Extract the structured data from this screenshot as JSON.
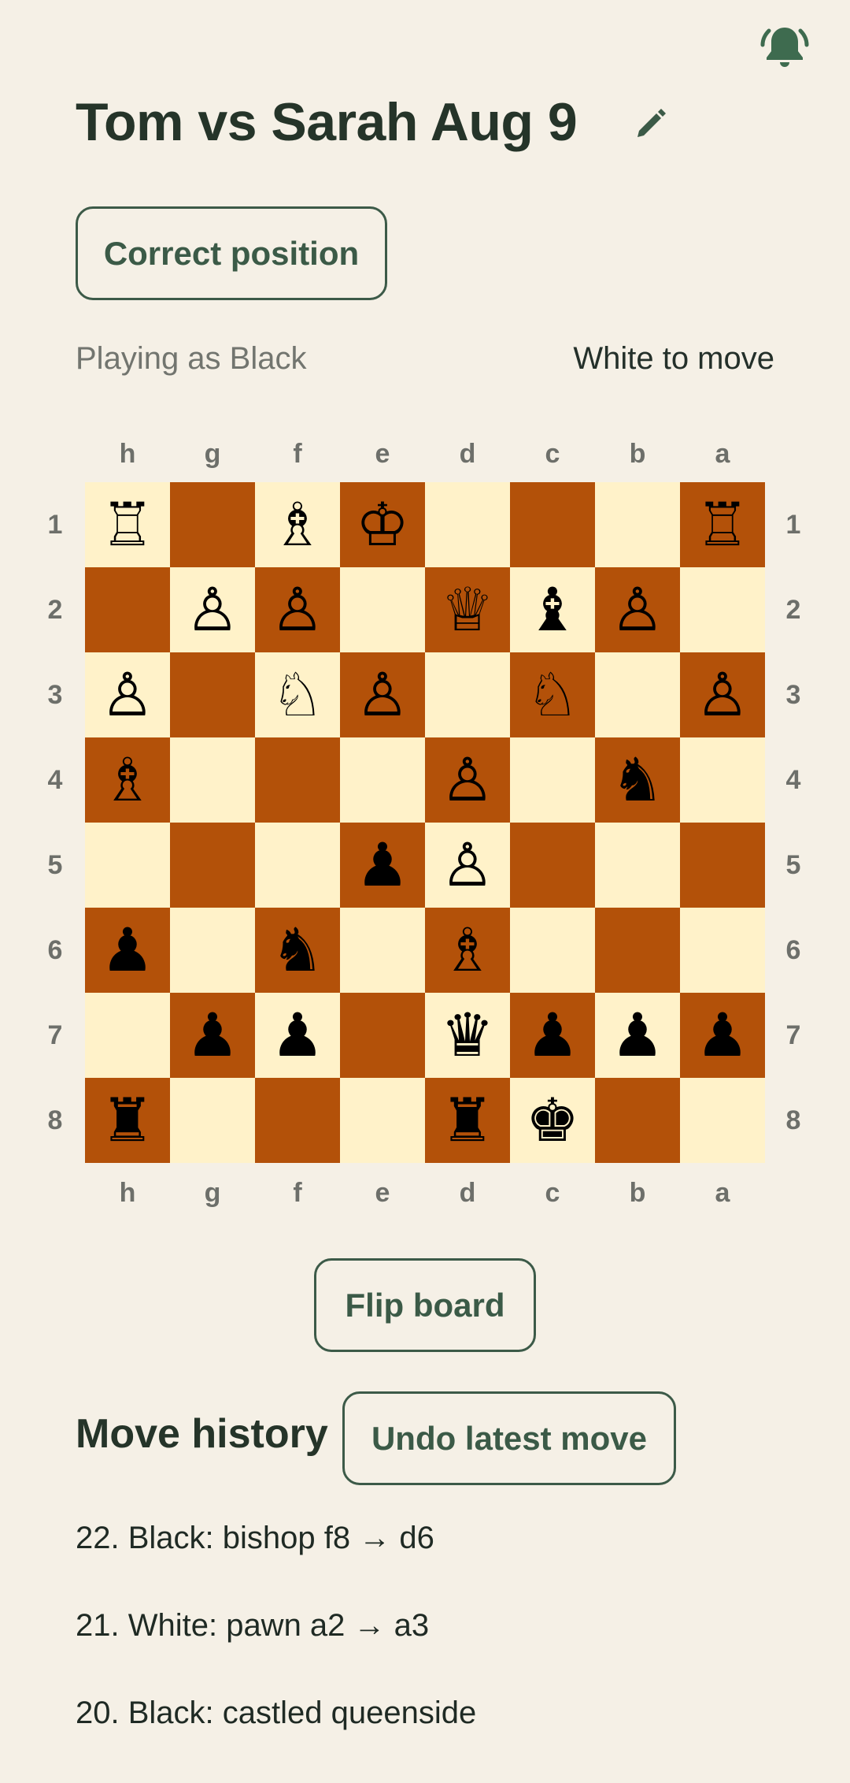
{
  "header": {
    "title": "Tom vs Sarah Aug 9",
    "notification_icon": "bell-icon",
    "edit_icon": "pencil-icon"
  },
  "actions": {
    "correct_position": "Correct position",
    "flip_board": "Flip board",
    "undo_latest_move": "Undo latest move"
  },
  "status": {
    "playing_as": "Playing as Black",
    "turn": "White to move"
  },
  "board": {
    "files": [
      "h",
      "g",
      "f",
      "e",
      "d",
      "c",
      "b",
      "a"
    ],
    "ranks": [
      "1",
      "2",
      "3",
      "4",
      "5",
      "6",
      "7",
      "8"
    ],
    "light_square_color": "#fff2c9",
    "dark_square_color": "#b35109",
    "rows": [
      [
        "♖",
        "",
        "♗",
        "♔",
        "",
        "",
        "",
        "♖"
      ],
      [
        "",
        "♙",
        "♙",
        "",
        "♕",
        "♝",
        "♙",
        ""
      ],
      [
        "♙",
        "",
        "♘",
        "♙",
        "",
        "♘",
        "",
        "♙"
      ],
      [
        "♗",
        "",
        "",
        "",
        "♙",
        "",
        "♞",
        ""
      ],
      [
        "",
        "",
        "",
        "♟",
        "♙",
        "",
        "",
        ""
      ],
      [
        "♟",
        "",
        "♞",
        "",
        "♗",
        "",
        "",
        ""
      ],
      [
        "",
        "♟",
        "♟",
        "",
        "♛",
        "♟",
        "♟",
        "♟"
      ],
      [
        "♜",
        "",
        "",
        "",
        "♜",
        "♚",
        "",
        ""
      ]
    ]
  },
  "history": {
    "title": "Move history",
    "moves": [
      "22. Black: bishop f8 → d6",
      "21. White: pawn a2 → a3",
      "20. Black: castled queenside"
    ]
  },
  "colors": {
    "background": "#f5f0e6",
    "accent": "#3c5a48"
  }
}
